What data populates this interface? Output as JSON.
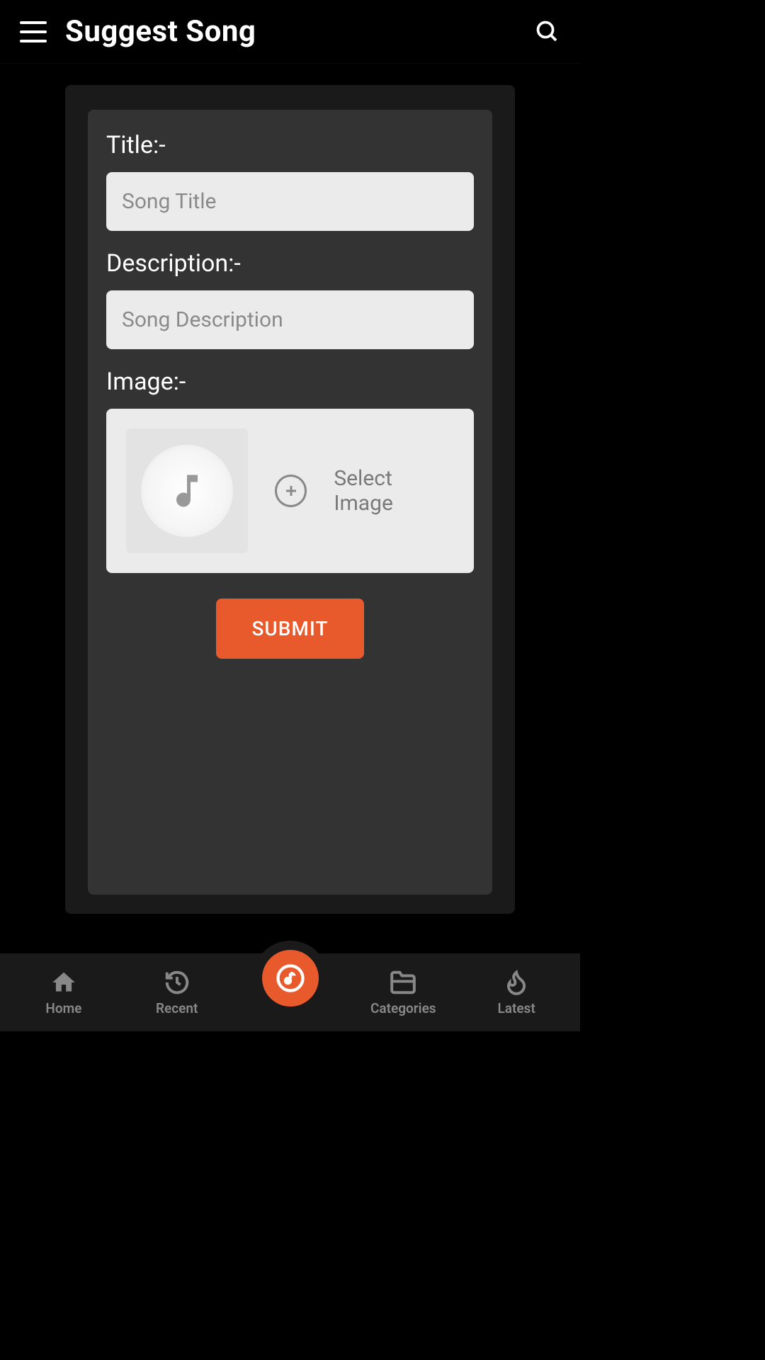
{
  "header": {
    "title": "Suggest Song"
  },
  "form": {
    "title_label": "Title:-",
    "title_placeholder": "Song Title",
    "description_label": "Description:-",
    "description_placeholder": "Song Description",
    "image_label": "Image:-",
    "select_image_text": "Select Image",
    "submit_label": "SUBMIT"
  },
  "nav": {
    "home": "Home",
    "recent": "Recent",
    "categories": "Categories",
    "latest": "Latest"
  },
  "colors": {
    "accent": "#e85a2c",
    "background": "#000000",
    "card": "#333333",
    "input": "#ebebeb"
  }
}
